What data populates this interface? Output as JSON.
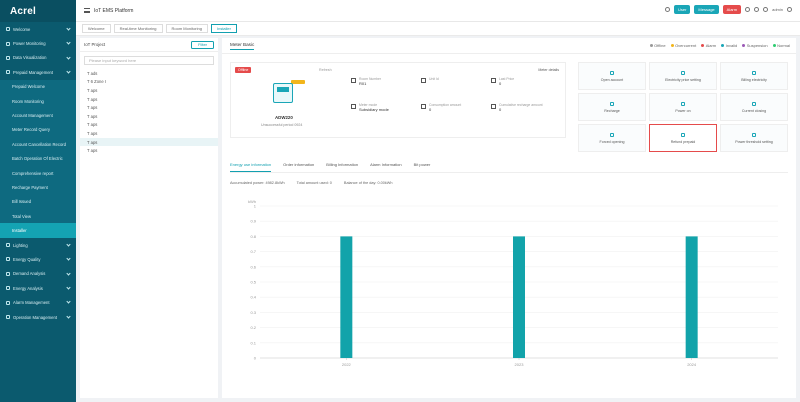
{
  "app": {
    "logo": "Acrel",
    "platform_title": "IoT EMS Platform"
  },
  "header": {
    "buttons": [
      {
        "label": "User",
        "color": "#1aa6b7"
      },
      {
        "label": "Message",
        "color": "#1aa6b7"
      },
      {
        "label": "Alarm",
        "color": "#e54b4b"
      }
    ],
    "text": "admin"
  },
  "sidebar": {
    "items": [
      {
        "label": "Welcome",
        "sub": false
      },
      {
        "label": "Power Monitoring",
        "sub": false
      },
      {
        "label": "Data Visualization",
        "sub": false
      },
      {
        "label": "Prepaid Management",
        "sub": false
      },
      {
        "label": "Prepaid Welcome",
        "sub": true
      },
      {
        "label": "Room Monitoring",
        "sub": true
      },
      {
        "label": "Account Management",
        "sub": true
      },
      {
        "label": "Meter Record Query",
        "sub": true
      },
      {
        "label": "Account Cancellation Record",
        "sub": true
      },
      {
        "label": "Batch Operation Of Electric",
        "sub": true
      },
      {
        "label": "Comprehensive report",
        "sub": true
      },
      {
        "label": "Recharge Payment",
        "sub": true
      },
      {
        "label": "Bill Issued",
        "sub": true
      },
      {
        "label": "Total View",
        "sub": true
      },
      {
        "label": "Installer",
        "sub": true,
        "active": true
      },
      {
        "label": "Lighting",
        "sub": false
      },
      {
        "label": "Energy Quality",
        "sub": false
      },
      {
        "label": "Demand Analysis",
        "sub": false
      },
      {
        "label": "Energy Analysis",
        "sub": false
      },
      {
        "label": "Alarm Management",
        "sub": false
      },
      {
        "label": "Operation Management",
        "sub": false
      }
    ]
  },
  "page_tabs": [
    {
      "label": "Welcome",
      "active": false
    },
    {
      "label": "Real-time Monitoring",
      "active": false
    },
    {
      "label": "Room Monitoring",
      "active": false
    },
    {
      "label": "Installer",
      "active": true
    }
  ],
  "tree": {
    "project_label": "IoT Project",
    "filter_label": "Filter",
    "search_placeholder": "Please input keyword here",
    "nodes": [
      {
        "label": "T ads",
        "selected": false
      },
      {
        "label": "T 6 Zone I",
        "selected": false
      },
      {
        "label": "T aps",
        "selected": false
      },
      {
        "label": "T aps",
        "selected": false
      },
      {
        "label": "T aps",
        "selected": false
      },
      {
        "label": "T aps",
        "selected": false
      },
      {
        "label": "T aps",
        "selected": false
      },
      {
        "label": "T aps",
        "selected": false
      },
      {
        "label": "T aps",
        "selected": true
      },
      {
        "label": "T aps",
        "selected": false
      }
    ]
  },
  "main": {
    "title": "Meter Basic",
    "legend": [
      {
        "label": "Offline",
        "color": "#999999"
      },
      {
        "label": "Overcurrent",
        "color": "#f2b51b"
      },
      {
        "label": "Alarm",
        "color": "#e54b4b"
      },
      {
        "label": "Invalid",
        "color": "#1aa6b7"
      },
      {
        "label": "Suspension",
        "color": "#9b59b6"
      },
      {
        "label": "Normal",
        "color": "#2ecc71"
      }
    ]
  },
  "meter": {
    "status": "Offline",
    "refresh_label": "Refresh",
    "details_label": "Meter details",
    "id": "ADW220",
    "subtitle": "Unsuccessful period 0924",
    "fields": [
      {
        "label": "Room Number",
        "value": "R01"
      },
      {
        "label": "Unit Id",
        "value": ""
      },
      {
        "label": "Last Price",
        "value": "0"
      },
      {
        "label": "Meter mode",
        "value": "Subsidiary mode"
      },
      {
        "label": "Consumption amount",
        "value": "0"
      },
      {
        "label": "Cumulative recharge amount",
        "value": "0"
      }
    ]
  },
  "operations": [
    {
      "label": "Open account",
      "highlight": false
    },
    {
      "label": "Electricity price setting",
      "highlight": false
    },
    {
      "label": "Billing electricity",
      "highlight": false
    },
    {
      "label": "Recharge",
      "highlight": false
    },
    {
      "label": "Power on",
      "highlight": false
    },
    {
      "label": "Current closing",
      "highlight": false
    },
    {
      "label": "Forced opening",
      "highlight": false
    },
    {
      "label": "Refund prepaid",
      "highlight": true
    },
    {
      "label": "Power threshold setting",
      "highlight": false
    }
  ],
  "subtabs": [
    {
      "label": "Energy use information",
      "active": true
    },
    {
      "label": "Order information",
      "active": false
    },
    {
      "label": "Billing Information",
      "active": false
    },
    {
      "label": "Alarm Information",
      "active": false
    },
    {
      "label": "Bit power",
      "active": false
    }
  ],
  "summary": [
    "Accumulated power: 4982.8kWh",
    "Total amount used: 0",
    "Balance of the day: 0.00kWh"
  ],
  "chart_data": {
    "type": "bar",
    "title": "",
    "xlabel": "",
    "ylabel": "",
    "unit": "kWh",
    "categories": [
      "2022",
      "2023",
      "2024"
    ],
    "values": [
      0.8,
      0.8,
      0.8
    ],
    "ylim": [
      0,
      1
    ],
    "yticks": [
      "0",
      "0.1",
      "0.2",
      "0.3",
      "0.4",
      "0.5",
      "0.6",
      "0.7",
      "0.8",
      "0.9",
      "1"
    ],
    "bar_color": "#12a3aa",
    "grid": true
  }
}
